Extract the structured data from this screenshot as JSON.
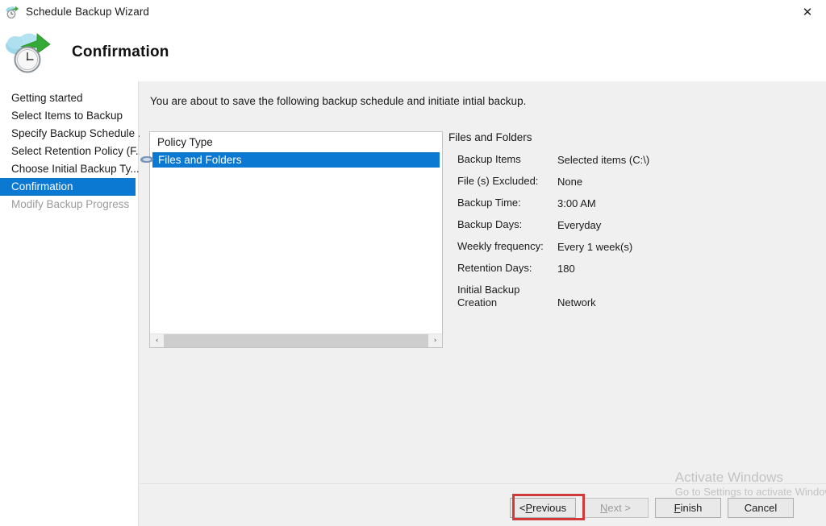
{
  "window": {
    "title": "Schedule Backup Wizard",
    "title_icon": "cloud-clock-icon",
    "close_label": "✕"
  },
  "header": {
    "title": "Confirmation",
    "icon": "cloud-backup-clock-icon"
  },
  "sidebar": {
    "items": [
      {
        "label": "Getting started",
        "state": "normal"
      },
      {
        "label": "Select Items to Backup",
        "state": "normal"
      },
      {
        "label": "Specify Backup Schedule ...",
        "state": "normal"
      },
      {
        "label": "Select Retention Policy (F...",
        "state": "normal"
      },
      {
        "label": "Choose Initial Backup Ty...",
        "state": "normal"
      },
      {
        "label": "Confirmation",
        "state": "active"
      },
      {
        "label": "Modify Backup Progress",
        "state": "disabled"
      }
    ]
  },
  "main": {
    "intro": "You are about to save the following backup schedule and initiate intial backup.",
    "listbox": {
      "column_header": "Policy Type",
      "rows": [
        {
          "label": "Files and Folders",
          "icon": "disk-icon",
          "selected": true
        }
      ],
      "scrollbar": {
        "left_arrow": "‹",
        "right_arrow": "›"
      }
    },
    "details": {
      "title": "Files and Folders",
      "rows": [
        {
          "label": "Backup Items",
          "value": "Selected items (C:\\)"
        },
        {
          "label": "File (s) Excluded:",
          "value": "None"
        },
        {
          "label": "Backup Time:",
          "value": "3:00 AM"
        },
        {
          "label": "Backup Days:",
          "value": "Everyday"
        },
        {
          "label": "Weekly frequency:",
          "value": "Every 1 week(s)"
        },
        {
          "label": "Retention Days:",
          "value": "180"
        },
        {
          "label": "Initial Backup",
          "label2": "Creation",
          "value": "Network"
        }
      ]
    }
  },
  "footer": {
    "previous": {
      "prefix": "< ",
      "mnemonic": "P",
      "rest": "revious",
      "enabled": true
    },
    "next": {
      "prefix": "",
      "mnemonic": "N",
      "rest": "ext >",
      "enabled": false
    },
    "finish": {
      "prefix": "",
      "mnemonic": "F",
      "rest": "inish",
      "enabled": true,
      "highlighted": true
    },
    "cancel": {
      "prefix": "",
      "mnemonic": "",
      "rest": "Cancel",
      "enabled": true
    }
  },
  "watermark": {
    "line1": "Activate Windows",
    "line2": "Go to Settings to activate Windows."
  },
  "colors": {
    "selection_blue": "#0b78d1",
    "annotation_red": "#d03a3a",
    "panel_gray": "#f0f0f0",
    "sidebar_white": "#ffffff"
  }
}
